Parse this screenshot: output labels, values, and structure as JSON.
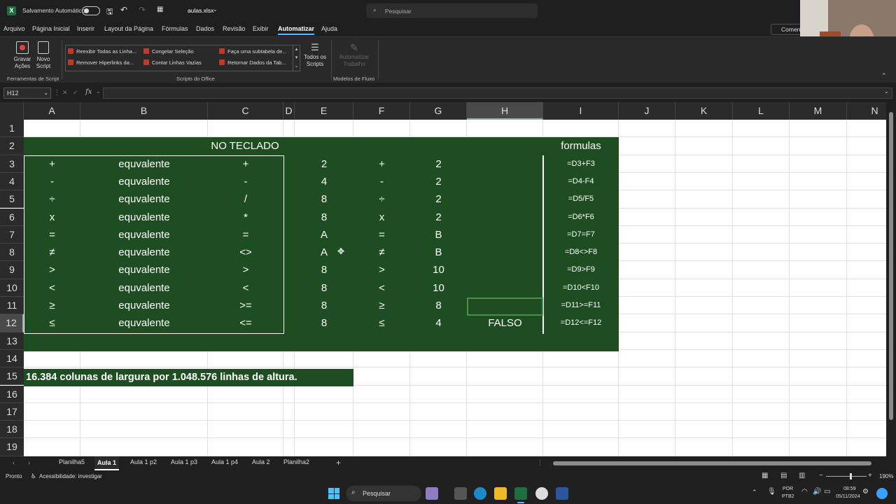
{
  "title": {
    "autosave_label": "Salvamento Automático",
    "file_name": "aulas.xlsx",
    "search_placeholder": "Pesquisar"
  },
  "menu": [
    "Arquivo",
    "Página Inicial",
    "Inserir",
    "Layout da Página",
    "Fórmulas",
    "Dados",
    "Revisão",
    "Exibir",
    "Automatizar",
    "Ajuda"
  ],
  "comment_btn": "Comen",
  "ribbon": {
    "record": "Gravar Ações",
    "new_script": "Novo Script",
    "group1": "Ferramentas de Script",
    "scripts": [
      "Reexibir Todas as Linha...",
      "Congelar Seleção",
      "Faça uma subtabela de...",
      "Remover Hiperlinks da...",
      "Contar Linhas Vazias",
      "Retornar Dados da Tab..."
    ],
    "all_scripts": "Todos os Scripts",
    "group2": "Scripts do Office",
    "automate": "Automatizar Trabalho",
    "group3": "Modelos de Fluxo"
  },
  "namebox": "H12",
  "columns": [
    "A",
    "B",
    "C",
    "D",
    "E",
    "F",
    "G",
    "H",
    "I",
    "J",
    "K",
    "L",
    "M",
    "N"
  ],
  "rows": [
    "1",
    "2",
    "3",
    "4",
    "5",
    "6",
    "7",
    "8",
    "9",
    "10",
    "11",
    "12",
    "13",
    "14",
    "15",
    "16",
    "17",
    "18",
    "19"
  ],
  "header_c2": "NO TECLADO",
  "header_i2": "formulas",
  "table": [
    [
      "+",
      "equvalente",
      "+",
      "2",
      "+",
      "2",
      "",
      "=D3+F3"
    ],
    [
      "-",
      "equvalente",
      "-",
      "4",
      "-",
      "2",
      "",
      "=D4-F4"
    ],
    [
      "÷",
      "equvalente",
      "/",
      "8",
      "÷",
      "2",
      "",
      "=D5/F5"
    ],
    [
      "x",
      "equvalente",
      "*",
      "8",
      "x",
      "2",
      "",
      "=D6*F6"
    ],
    [
      "=",
      "equvalente",
      "=",
      "A",
      "=",
      "B",
      "",
      "=D7=F7"
    ],
    [
      "≠",
      "equvalente",
      "<>",
      "A",
      "≠",
      "B",
      "",
      "=D8<>F8"
    ],
    [
      ">",
      "equvalente",
      ">",
      "8",
      ">",
      "10",
      "",
      "=D9>F9"
    ],
    [
      "<",
      "equvalente",
      "<",
      "8",
      "<",
      "10",
      "",
      "=D10<F10"
    ],
    [
      "≥",
      "equvalente",
      ">=",
      "8",
      "≥",
      "8",
      "",
      "=D11>=F11"
    ],
    [
      "≤",
      "equvalente",
      "<=",
      "8",
      "≤",
      "4",
      "FALSO",
      "=D12<=F12"
    ]
  ],
  "note": "16.384 colunas de largura por 1.048.576 linhas de altura.",
  "sheets": [
    "Planilha5",
    "Aula 1",
    "Aula 1 p2",
    "Aula 1 p3",
    "Aula 1 p4",
    "Aula 2",
    "Planilha2"
  ],
  "status": {
    "ready": "Pronto",
    "accessibility": "Acessibilidade: investigar",
    "zoom": "190%"
  },
  "taskbar": {
    "search": "Pesquisar",
    "lang": "POR",
    "kbd": "PTB2",
    "time": "08:59",
    "date": "05/11/2024"
  },
  "colors": {
    "green": "#1e4d21",
    "accent": "#4cc2ff"
  }
}
